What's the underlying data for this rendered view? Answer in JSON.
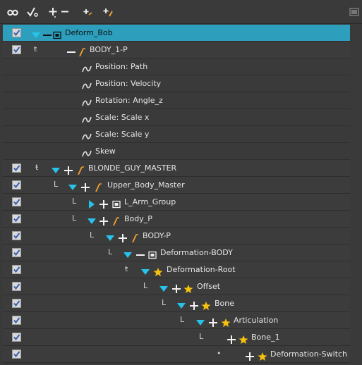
{
  "toolbar": {
    "buttons": [
      {
        "name": "show-all-icon",
        "glyph": "∞"
      },
      {
        "name": "enable-all-icon",
        "glyph": "√"
      },
      {
        "name": "add-icon",
        "glyph": "+"
      },
      {
        "name": "remove-icon",
        "glyph": "−"
      },
      {
        "name": "add-peg-icon",
        "glyph": "+"
      },
      {
        "name": "add-drawing-icon",
        "glyph": "+"
      }
    ]
  },
  "colors": {
    "selected": "#2d9fbd",
    "row": "#3c3c3c",
    "arrow": "#27c3ea",
    "star": "#f7c20e"
  },
  "rows": [
    {
      "id": "r0",
      "label": "Deform_Bob",
      "checkbox": true,
      "selected": true,
      "type": "group",
      "expand": "down",
      "plus": false,
      "minus": true
    },
    {
      "id": "r1",
      "label": "BODY_1-P",
      "checkbox": true,
      "type": "peg",
      "connector": "ŧ",
      "minus": true
    },
    {
      "id": "r2",
      "label": "Position: Path",
      "checkbox": false,
      "type": "function"
    },
    {
      "id": "r3",
      "label": "Position: Velocity",
      "checkbox": false,
      "type": "function"
    },
    {
      "id": "r4",
      "label": "Rotation: Angle_z",
      "checkbox": false,
      "type": "function"
    },
    {
      "id": "r5",
      "label": "Scale: Scale x",
      "checkbox": false,
      "type": "function"
    },
    {
      "id": "r6",
      "label": "Scale: Scale y",
      "checkbox": false,
      "type": "function"
    },
    {
      "id": "r7",
      "label": "Skew",
      "checkbox": false,
      "type": "function"
    },
    {
      "id": "r8",
      "label": "BLONDE_GUY_MASTER",
      "checkbox": true,
      "type": "peg",
      "connector": "ŧ",
      "expand": "down",
      "plus": true
    },
    {
      "id": "r9",
      "label": "Upper_Body_Master",
      "checkbox": true,
      "type": "peg",
      "connector": "L",
      "expand": "down",
      "plus": true
    },
    {
      "id": "r10",
      "label": "L_Arm_Group",
      "checkbox": true,
      "type": "group",
      "connector": "L",
      "expand": "right",
      "plus": true
    },
    {
      "id": "r11",
      "label": "Body_P",
      "checkbox": true,
      "type": "peg",
      "connector": "L",
      "expand": "down",
      "plus": true
    },
    {
      "id": "r12",
      "label": "BODY-P",
      "checkbox": true,
      "type": "peg",
      "connector": "L",
      "expand": "down",
      "plus": true
    },
    {
      "id": "r13",
      "label": "Deformation-BODY",
      "checkbox": true,
      "type": "group",
      "connector": "L",
      "expand": "down",
      "minus": true
    },
    {
      "id": "r14",
      "label": "Deformation-Root",
      "checkbox": true,
      "type": "star",
      "connector": "ŧ",
      "expand": "down"
    },
    {
      "id": "r15",
      "label": "Offset",
      "checkbox": true,
      "type": "star",
      "connector": "L",
      "expand": "down",
      "plus": true
    },
    {
      "id": "r16",
      "label": "Bone",
      "checkbox": true,
      "type": "star",
      "connector": "L",
      "expand": "down",
      "plus": true
    },
    {
      "id": "r17",
      "label": "Articulation",
      "checkbox": true,
      "type": "star",
      "connector": "L",
      "expand": "down",
      "plus": true
    },
    {
      "id": "r18",
      "label": "Bone_1",
      "checkbox": true,
      "type": "star",
      "connector": "L",
      "plus": true
    },
    {
      "id": "r19",
      "label": "Deformation-Switch",
      "checkbox": true,
      "type": "star",
      "connector": "•",
      "plus": true
    }
  ]
}
